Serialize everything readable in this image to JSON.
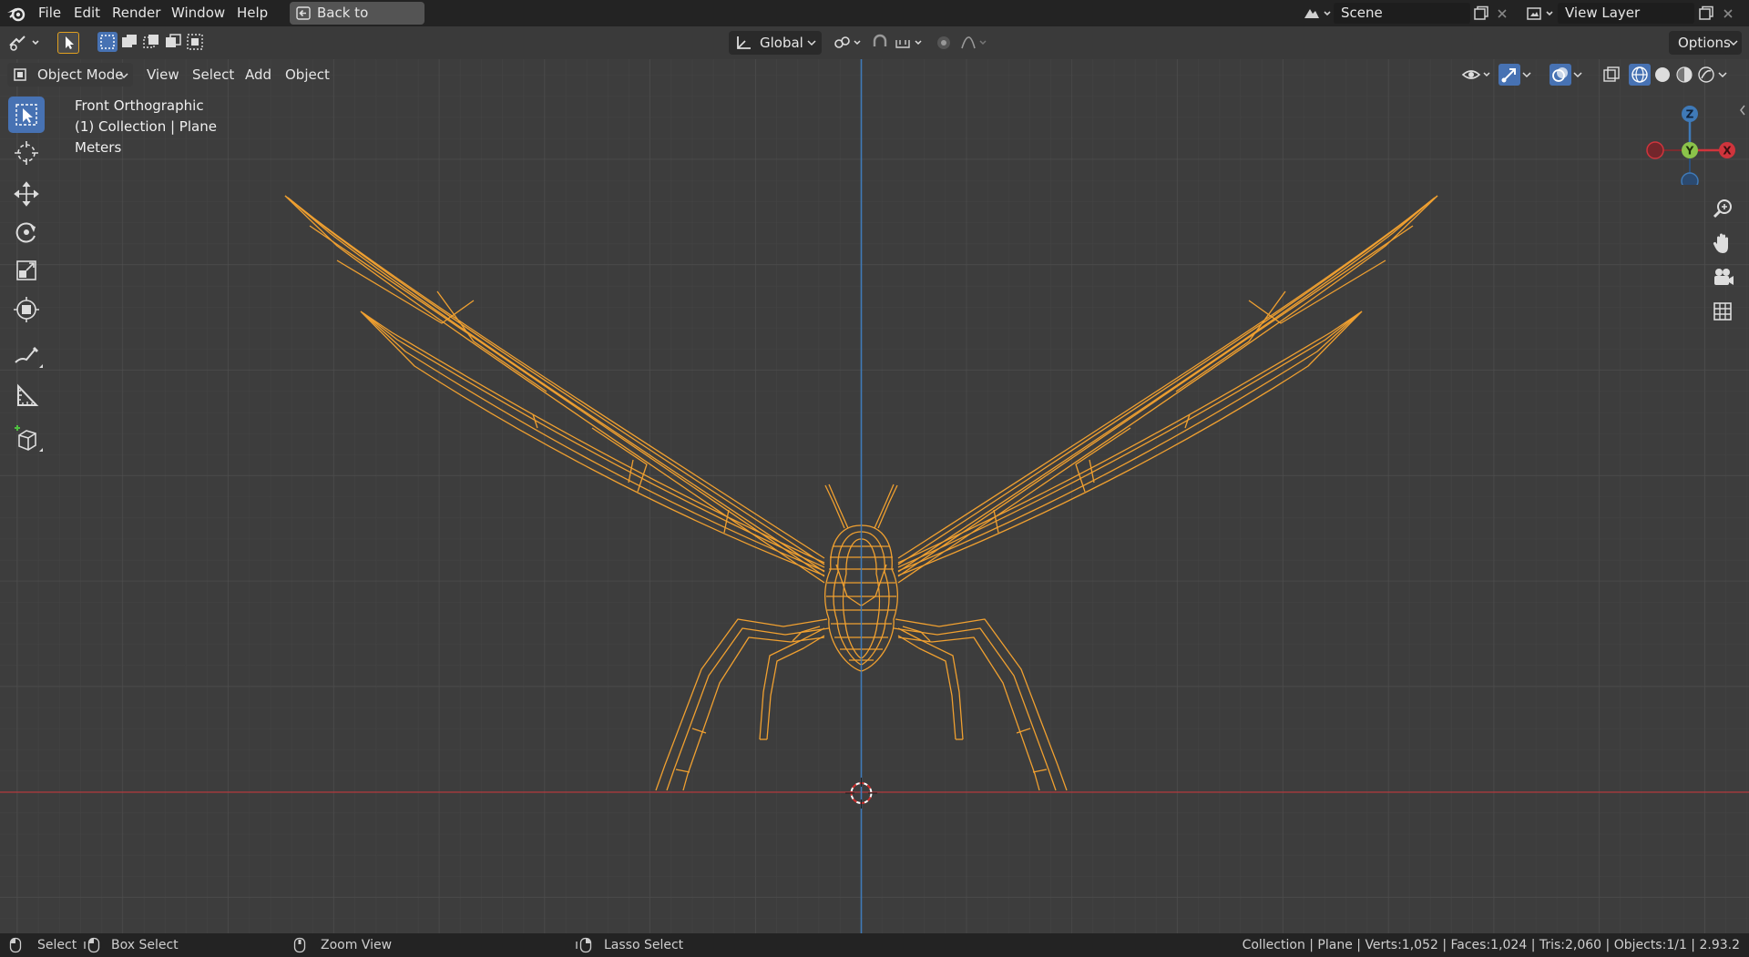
{
  "menubar": {
    "items": [
      "File",
      "Edit",
      "Render",
      "Window",
      "Help"
    ],
    "back_label": "Back to Previous",
    "scene_label": "Scene",
    "view_layer_label": "View Layer"
  },
  "header": {
    "orientation": "Global",
    "options_label": "Options"
  },
  "viewport": {
    "mode": "Object Mode",
    "menus": [
      "View",
      "Select",
      "Add",
      "Object"
    ],
    "overlay": {
      "view_name": "Front Orthographic",
      "collection": "(1) Collection | Plane",
      "units": "Meters"
    },
    "gizmo": {
      "z": "Z",
      "y": "Y",
      "x": "X"
    },
    "selection_color": "#f0a030"
  },
  "statusbar": {
    "select": "Select",
    "box_select": "Box Select",
    "zoom_view": "Zoom View",
    "lasso_select": "Lasso Select",
    "stats": "Collection | Plane | Verts:1,052 | Faces:1,024 | Tris:2,060 | Objects:1/1 | 2.93.2"
  }
}
